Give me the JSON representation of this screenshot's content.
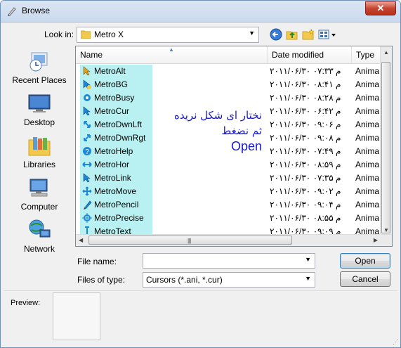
{
  "window": {
    "title": "Browse",
    "close_glyph": "✕"
  },
  "lookin": {
    "label": "Look in:",
    "value": "Metro X"
  },
  "toolbar": {
    "back_icon": "back-icon",
    "up_icon": "up-folder-icon",
    "new_folder_icon": "new-folder-icon",
    "views_icon": "views-menu-icon"
  },
  "places": [
    {
      "label": "Recent Places",
      "icon": "recent-places-icon"
    },
    {
      "label": "Desktop",
      "icon": "desktop-icon"
    },
    {
      "label": "Libraries",
      "icon": "libraries-icon"
    },
    {
      "label": "Computer",
      "icon": "computer-icon"
    },
    {
      "label": "Network",
      "icon": "network-icon"
    }
  ],
  "columns": {
    "name": "Name",
    "date": "Date modified",
    "type": "Type"
  },
  "files": [
    {
      "name": "MetroAlt",
      "date": "۲۰۱۱/۰۶/۳۰ م ۰۷:۳۳",
      "type": "Anima"
    },
    {
      "name": "MetroBG",
      "date": "۲۰۱۱/۰۶/۳۰ م ۰۸:۴۱",
      "type": "Anima"
    },
    {
      "name": "MetroBusy",
      "date": "۲۰۱۱/۰۶/۳۰ م ۰۸:۲۸",
      "type": "Anima"
    },
    {
      "name": "MetroCur",
      "date": "۲۰۱۱/۰۶/۳۰ م ۰۶:۴۲",
      "type": "Anima"
    },
    {
      "name": "MetroDwnLft",
      "date": "۲۰۱۱/۰۶/۳۰ م ۰۹:۰۶",
      "type": "Anima"
    },
    {
      "name": "MetroDwnRgt",
      "date": "۲۰۱۱/۰۶/۳۰ م ۰۹:۰۸",
      "type": "Anima"
    },
    {
      "name": "MetroHelp",
      "date": "۲۰۱۱/۰۶/۳۰ م ۰۷:۴۹",
      "type": "Anima"
    },
    {
      "name": "MetroHor",
      "date": "۲۰۱۱/۰۶/۳۰ م ۰۸:۵۹",
      "type": "Anima"
    },
    {
      "name": "MetroLink",
      "date": "۲۰۱۱/۰۶/۳۰ م ۰۷:۳۵",
      "type": "Anima"
    },
    {
      "name": "MetroMove",
      "date": "۲۰۱۱/۰۶/۳۰ م ۰۹:۰۲",
      "type": "Anima"
    },
    {
      "name": "MetroPencil",
      "date": "۲۰۱۱/۰۶/۳۰ م ۰۹:۰۴",
      "type": "Anima"
    },
    {
      "name": "MetroPrecise",
      "date": "۲۰۱۱/۰۶/۳۰ م ۰۸:۵۵",
      "type": "Anima"
    },
    {
      "name": "MetroText",
      "date": "۲۰۱۱/۰۶/۳۰ م ۰۹:۰۹",
      "type": "Anima"
    }
  ],
  "annotation": {
    "line1": "نختار ای شكل نريده",
    "line2": "ثم نضغط",
    "line3": "Open",
    "color": "#1a1acc"
  },
  "filename": {
    "label": "File name:",
    "value": ""
  },
  "filetype": {
    "label": "Files of type:",
    "value": "Cursors (*.ani, *.cur)"
  },
  "buttons": {
    "open": "Open",
    "cancel": "Cancel"
  },
  "preview": {
    "label": "Preview:"
  },
  "colors": {
    "highlight": "#b9f0f2",
    "accent": "#3c7fb1"
  }
}
